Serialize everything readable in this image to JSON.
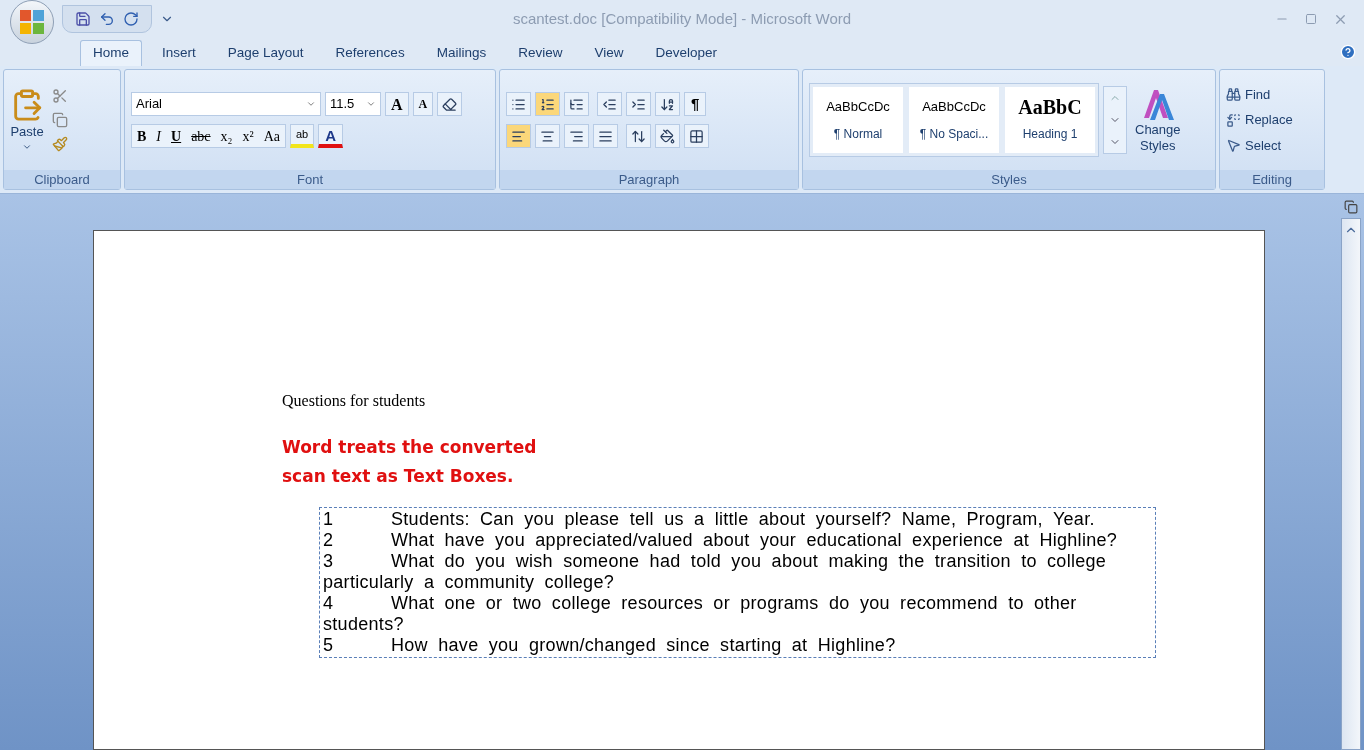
{
  "window": {
    "title": "scantest.doc [Compatibility Mode] - Microsoft Word"
  },
  "tabs": [
    {
      "label": "Home",
      "selected": true
    },
    {
      "label": "Insert",
      "selected": false
    },
    {
      "label": "Page Layout",
      "selected": false
    },
    {
      "label": "References",
      "selected": false
    },
    {
      "label": "Mailings",
      "selected": false
    },
    {
      "label": "Review",
      "selected": false
    },
    {
      "label": "View",
      "selected": false
    },
    {
      "label": "Developer",
      "selected": false
    }
  ],
  "clipboard": {
    "paste": "Paste",
    "label": "Clipboard"
  },
  "font": {
    "name": "Arial",
    "size": "11.5",
    "grow": "A",
    "shrink": "A",
    "format_buttons": [
      "B",
      "I",
      "U",
      "abc",
      "x₂",
      "x²",
      "Aa"
    ],
    "highlight": "ab",
    "font_color": "A",
    "label": "Font"
  },
  "paragraph": {
    "numbering_selected": true,
    "align_left_selected": true,
    "pilcrow": "¶",
    "label": "Paragraph"
  },
  "styles": {
    "items": [
      {
        "preview": "AaBbCcDc",
        "name": "¶ Normal",
        "selected": false
      },
      {
        "preview": "AaBbCcDc",
        "name": "¶ No Spaci...",
        "selected": false
      },
      {
        "preview": "AaBbC",
        "name": "Heading 1",
        "selected": false
      }
    ],
    "change_styles": [
      "Change",
      "Styles"
    ],
    "label": "Styles"
  },
  "editing": {
    "find": "Find",
    "replace": "Replace",
    "select": "Select",
    "label": "Editing"
  },
  "document": {
    "heading": "Questions for students",
    "note": [
      "Word treats the converted",
      "scan text as Text Boxes."
    ],
    "questions": [
      {
        "number": "1",
        "text": "Students: Can you please tell us a little about yourself? Name, Program, Year."
      },
      {
        "number": "2",
        "text": "What have you appreciated/valued about your educational experience at Highline?"
      },
      {
        "number": "3",
        "text": "What do you wish someone had told you about making the transition to college particularly a community college?"
      },
      {
        "number": "4",
        "text": "What one or two college resources or programs do you recommend to other students?"
      },
      {
        "number": "5",
        "text": "How have you grown/changed since starting at Highline?"
      }
    ]
  }
}
